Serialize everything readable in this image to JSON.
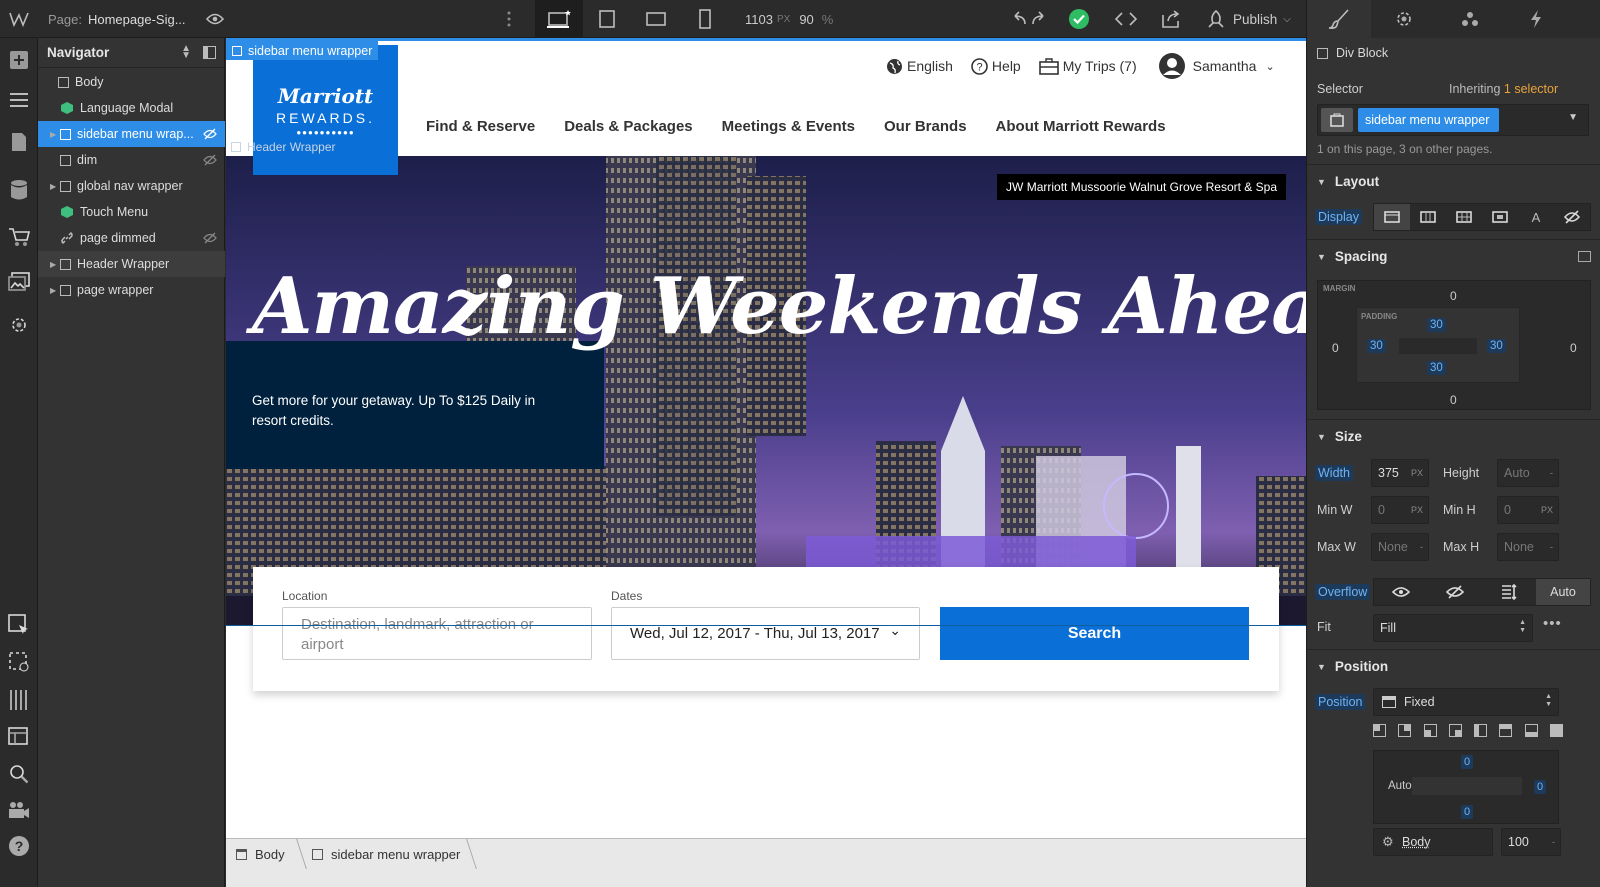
{
  "topbar": {
    "page_label": "Page:",
    "page_name": "Homepage-Sig...",
    "width_value": "1103",
    "width_unit": "PX",
    "zoom_value": "90",
    "zoom_unit": "%",
    "publish_label": "Publish"
  },
  "navigator": {
    "title": "Navigator",
    "items": [
      {
        "label": "Body",
        "icon": "box-icon",
        "indent": 0,
        "expandable": false
      },
      {
        "label": "Language Modal",
        "icon": "component-icon",
        "indent": 1,
        "expandable": false
      },
      {
        "label": "sidebar menu wrap...",
        "icon": "box-icon",
        "indent": 1,
        "expandable": true,
        "selected": true
      },
      {
        "label": "dim",
        "icon": "box-icon",
        "indent": 1,
        "expandable": false
      },
      {
        "label": "global nav wrapper",
        "icon": "box-icon",
        "indent": 1,
        "expandable": true
      },
      {
        "label": "Touch Menu",
        "icon": "component-icon",
        "indent": 1,
        "expandable": false
      },
      {
        "label": "page dimmed",
        "icon": "link-icon",
        "indent": 1,
        "expandable": false
      },
      {
        "label": "Header Wrapper",
        "icon": "box-icon",
        "indent": 1,
        "expandable": true
      },
      {
        "label": "page wrapper",
        "icon": "box-icon",
        "indent": 1,
        "expandable": true
      }
    ]
  },
  "canvas": {
    "selection_tag": "sidebar menu wrapper",
    "ghost_label": "Header Wrapper",
    "logo_script": "Marriott",
    "logo_rewards": "REWARDS.",
    "util_links": [
      "English",
      "Help",
      "My Trips (7)",
      "Samantha"
    ],
    "main_nav": [
      "Find & Reserve",
      "Deals & Packages",
      "Meetings & Events",
      "Our Brands",
      "About Marriott Rewards"
    ],
    "hotel_badge": "JW Marriott Mussoorie Walnut Grove Resort & Spa",
    "hero_title": "Amazing Weekends Ahead",
    "promo_text": "Get more for your getaway. Up To $125 Daily in resort credits.",
    "location_label": "Location",
    "location_placeholder": "Destination, landmark, attraction or airport",
    "dates_label": "Dates",
    "dates_value": "Wed, Jul 12, 2017 - Thu, Jul 13, 2017",
    "search_label": "Search"
  },
  "breadcrumb": [
    "Body",
    "sidebar menu wrapper"
  ],
  "style_panel": {
    "element_type": "Div Block",
    "selector_label": "Selector",
    "inheriting_label": "Inheriting",
    "inheriting_count": "1 selector",
    "selector_value": "sidebar menu wrapper",
    "selector_info": "1 on this page, 3 on other pages.",
    "layout_title": "Layout",
    "display_label": "Display",
    "spacing_title": "Spacing",
    "margin_label": "MARGIN",
    "padding_label": "PADDING",
    "margin": {
      "top": "0",
      "right": "0",
      "bottom": "0",
      "left": "0"
    },
    "padding": {
      "top": "30",
      "right": "30",
      "bottom": "30",
      "left": "30"
    },
    "size_title": "Size",
    "width_label": "Width",
    "width_value": "375",
    "width_unit": "PX",
    "height_label": "Height",
    "height_value": "Auto",
    "height_unit": "-",
    "minw_label": "Min W",
    "minw_value": "0",
    "minw_unit": "PX",
    "minh_label": "Min H",
    "minh_value": "0",
    "minh_unit": "PX",
    "maxw_label": "Max W",
    "maxw_value": "None",
    "maxw_unit": "-",
    "maxh_label": "Max H",
    "maxh_value": "None",
    "maxh_unit": "-",
    "overflow_label": "Overflow",
    "overflow_auto": "Auto",
    "fit_label": "Fit",
    "fit_value": "Fill",
    "position_title": "Position",
    "position_label": "Position",
    "position_value": "Fixed",
    "offset": {
      "top": "0",
      "right": "0",
      "bottom": "0",
      "left": "Auto"
    },
    "relative_to": "Body",
    "zindex": "100"
  },
  "colors": {
    "accent": "#2e8de6",
    "navy": "#00213d",
    "search_btn": "#0a6fd6",
    "inherit": "#e8a33d"
  }
}
